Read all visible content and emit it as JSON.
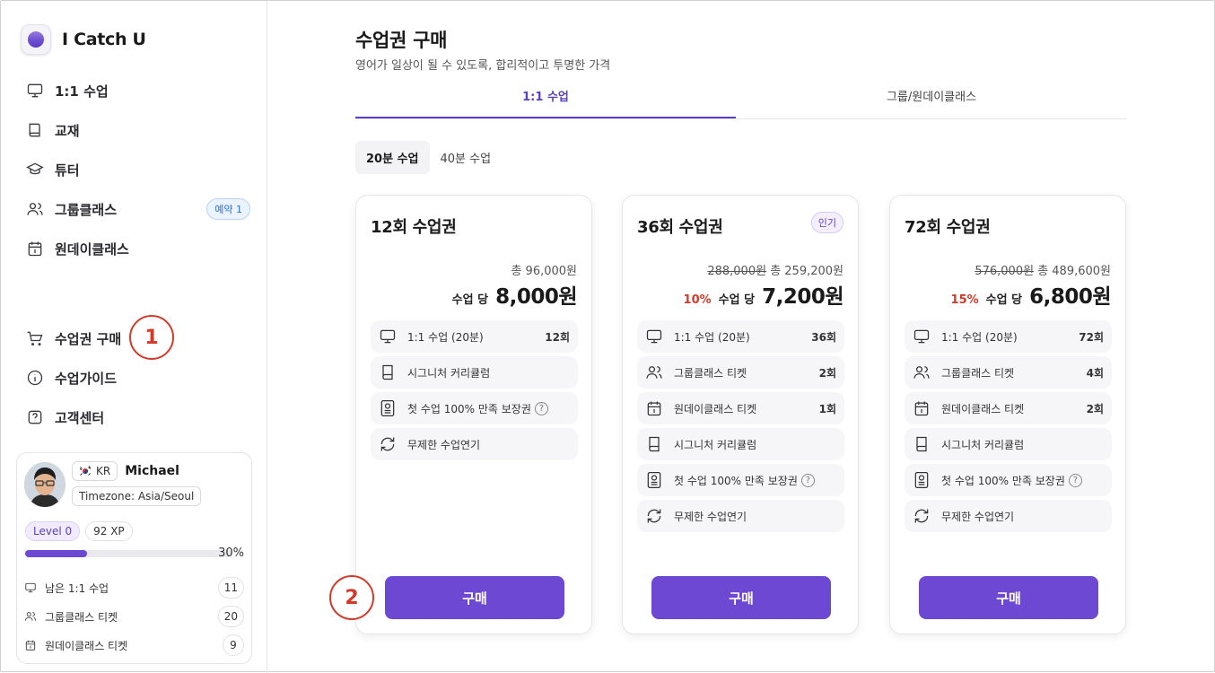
{
  "brand": {
    "name": "I Catch U"
  },
  "nav_top": [
    {
      "label": "1:1 수업",
      "icon": "monitor-icon"
    },
    {
      "label": "교재",
      "icon": "book-icon"
    },
    {
      "label": "튜터",
      "icon": "graduation-cap-icon"
    },
    {
      "label": "그룹클래스",
      "icon": "users-icon",
      "badge": "예약 1"
    },
    {
      "label": "원데이클래스",
      "icon": "calendar-icon"
    }
  ],
  "nav_bottom": [
    {
      "label": "수업권 구매",
      "icon": "cart-icon"
    },
    {
      "label": "수업가이드",
      "icon": "info-icon"
    },
    {
      "label": "고객센터",
      "icon": "help-icon"
    }
  ],
  "annotations": {
    "one": "1",
    "two": "2"
  },
  "profile": {
    "country": "KR",
    "name": "Michael",
    "timezone": "Timezone: Asia/Seoul",
    "level": "Level 0",
    "xp": "92 XP",
    "progress_text": "30%",
    "progress": 0.3,
    "stats": [
      {
        "label": "남은 1:1 수업",
        "count": "11",
        "icon": "monitor-icon"
      },
      {
        "label": "그룹클래스 티켓",
        "count": "20",
        "icon": "users-icon"
      },
      {
        "label": "원데이클래스 티켓",
        "count": "9",
        "icon": "calendar-icon"
      }
    ]
  },
  "page": {
    "title": "수업권 구매",
    "subtitle": "영어가 일상이 될 수 있도록, 합리적이고 투명한 가격",
    "tabs": [
      "1:1 수업",
      "그룹/원데이클래스"
    ],
    "durations": [
      "20분 수업",
      "40분 수업"
    ]
  },
  "accent": "#6d48d3",
  "cards": [
    {
      "title": "12회 수업권",
      "badge": "",
      "original": "",
      "total": "총 96,000원",
      "discount": "",
      "per_label": "수업 당",
      "price": "8,000원",
      "features": [
        {
          "icon": "monitor-icon",
          "label": "1:1 수업 (20분)",
          "count": "12회",
          "help": false
        },
        {
          "icon": "book-icon",
          "label": "시그니처 커리큘럼",
          "count": "",
          "help": false
        },
        {
          "icon": "certificate-icon",
          "label": "첫 수업 100% 만족 보장권",
          "count": "",
          "help": true
        },
        {
          "icon": "refresh-icon",
          "label": "무제한 수업연기",
          "count": "",
          "help": false
        }
      ],
      "button": "구매"
    },
    {
      "title": "36회 수업권",
      "badge": "인기",
      "original": "288,000원",
      "total": "총 259,200원",
      "discount": "10%",
      "per_label": "수업 당",
      "price": "7,200원",
      "features": [
        {
          "icon": "monitor-icon",
          "label": "1:1 수업 (20분)",
          "count": "36회",
          "help": false
        },
        {
          "icon": "users-icon",
          "label": "그룹클래스 티켓",
          "count": "2회",
          "help": false
        },
        {
          "icon": "calendar-icon",
          "label": "원데이클래스 티켓",
          "count": "1회",
          "help": false
        },
        {
          "icon": "book-icon",
          "label": "시그니처 커리큘럼",
          "count": "",
          "help": false
        },
        {
          "icon": "certificate-icon",
          "label": "첫 수업 100% 만족 보장권",
          "count": "",
          "help": true
        },
        {
          "icon": "refresh-icon",
          "label": "무제한 수업연기",
          "count": "",
          "help": false
        }
      ],
      "button": "구매"
    },
    {
      "title": "72회 수업권",
      "badge": "",
      "original": "576,000원",
      "total": "총 489,600원",
      "discount": "15%",
      "per_label": "수업 당",
      "price": "6,800원",
      "features": [
        {
          "icon": "monitor-icon",
          "label": "1:1 수업 (20분)",
          "count": "72회",
          "help": false
        },
        {
          "icon": "users-icon",
          "label": "그룹클래스 티켓",
          "count": "4회",
          "help": false
        },
        {
          "icon": "calendar-icon",
          "label": "원데이클래스 티켓",
          "count": "2회",
          "help": false
        },
        {
          "icon": "book-icon",
          "label": "시그니처 커리큘럼",
          "count": "",
          "help": false
        },
        {
          "icon": "certificate-icon",
          "label": "첫 수업 100% 만족 보장권",
          "count": "",
          "help": true
        },
        {
          "icon": "refresh-icon",
          "label": "무제한 수업연기",
          "count": "",
          "help": false
        }
      ],
      "button": "구매"
    }
  ]
}
